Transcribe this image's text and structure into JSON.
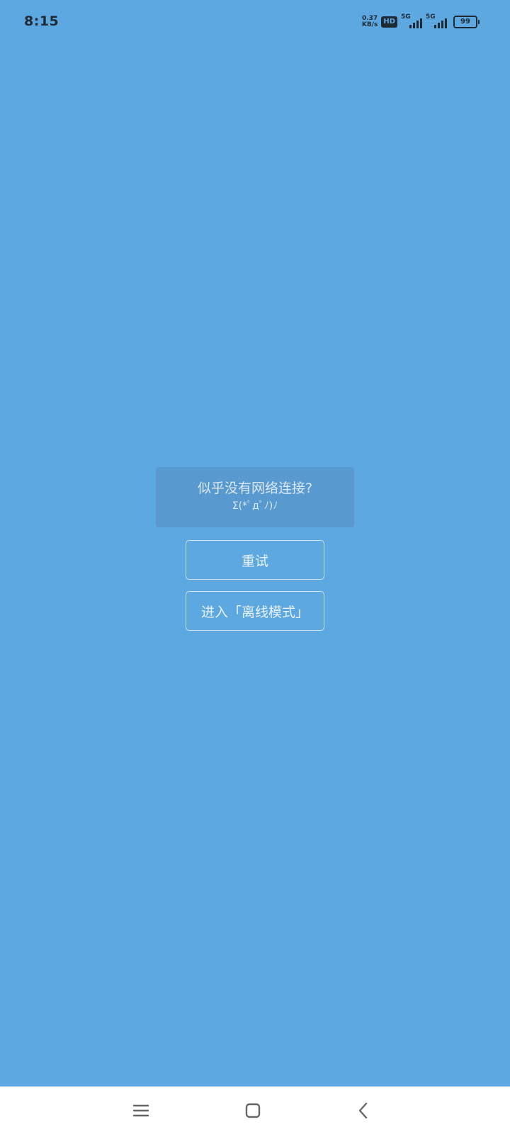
{
  "status_bar": {
    "time": "8:15",
    "net_speed_value": "0.37",
    "net_speed_unit": "KB/s",
    "hd_label": "HD",
    "sim1_label": "5G",
    "sim2_label": "5G",
    "battery_level": "99",
    "icons": [
      "hd-voice-icon",
      "signal-icon",
      "signal-icon",
      "battery-icon"
    ]
  },
  "offline_prompt": {
    "title": "似乎没有网络连接?",
    "face": "Σ(*ﾟдﾟﾉ)ﾉ",
    "retry_label": "重试",
    "offline_mode_label": "进入「离线模式」"
  },
  "nav_bar": {
    "icons": [
      "menu-icon",
      "home-icon",
      "back-icon"
    ]
  },
  "colors": {
    "background": "#5da8e0",
    "card": "#5899cf",
    "button_border": "#cfe3f4",
    "nav_bar": "#ffffff"
  }
}
